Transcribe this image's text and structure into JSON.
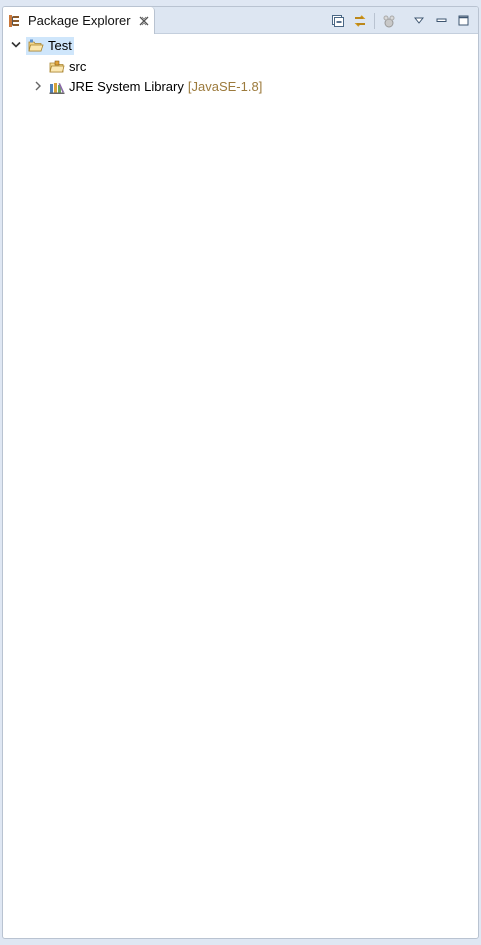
{
  "view": {
    "tab_title": "Package Explorer",
    "tab_icon": "package-explorer-icon",
    "close_icon": "close-icon"
  },
  "toolbar": {
    "buttons": [
      {
        "name": "collapse-all-icon"
      },
      {
        "name": "link-with-editor-icon"
      },
      {
        "name": "focus-on-active-task-icon"
      },
      {
        "name": "view-menu-icon"
      },
      {
        "name": "minimize-icon"
      },
      {
        "name": "maximize-icon"
      }
    ]
  },
  "tree": {
    "project": {
      "label": "Test",
      "expanded": true,
      "selected": true,
      "icon": "java-project-folder-icon"
    },
    "children": [
      {
        "label": "src",
        "icon": "source-folder-icon",
        "decoration": ""
      },
      {
        "label": "JRE System Library",
        "icon": "library-icon",
        "decoration": "[JavaSE-1.8]",
        "expanded": false
      }
    ]
  },
  "colors": {
    "selection": "#cfe6fb",
    "decoration_text": "#9c7a3c",
    "tab_bar": "#dde6f2",
    "border": "#b9c3d1"
  }
}
